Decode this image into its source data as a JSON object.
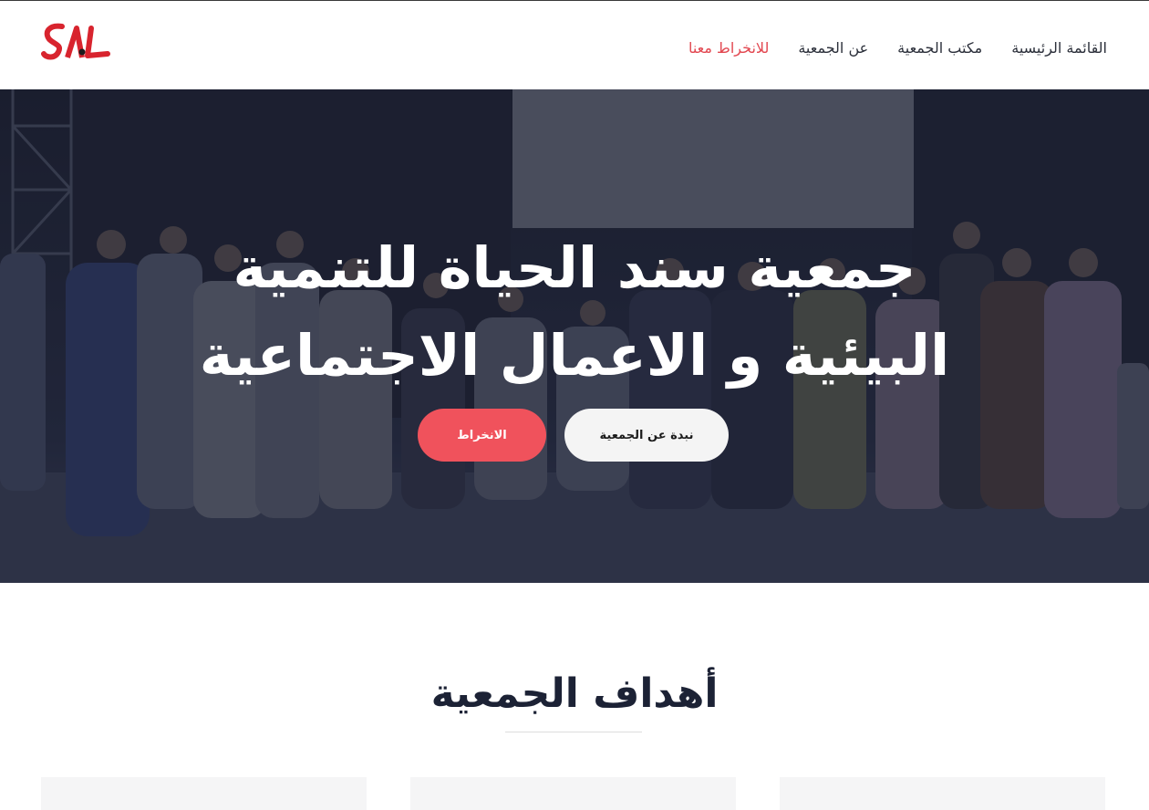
{
  "header": {
    "logo_text": "SAL",
    "nav": [
      {
        "label": "القائمة الرئيسية"
      },
      {
        "label": "مكتب الجمعية"
      },
      {
        "label": "عن الجمعية"
      },
      {
        "label": "للانخراط معنا"
      }
    ]
  },
  "hero": {
    "title_line1": "جمعية سند الحياة للتنمية",
    "title_line2": "البيئية و الاعمال الاجتماعية",
    "about_button": "نبدة عن الجمعية",
    "join_button": "الانخراط"
  },
  "goals": {
    "title": "أهداف الجمعية"
  },
  "colors": {
    "accent": "#e2464f",
    "button_red": "#f0525c",
    "overlay": "#1f2438"
  }
}
